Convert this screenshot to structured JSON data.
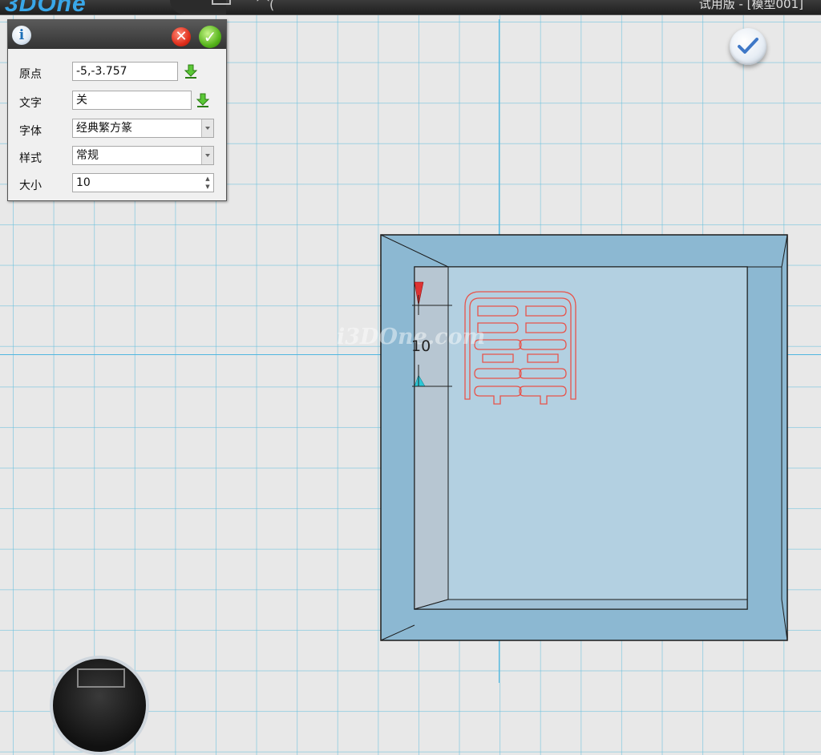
{
  "app": {
    "logo": "3DOne",
    "window_title": "试用版 - [模型001]"
  },
  "panel": {
    "rows": [
      {
        "label": "原点",
        "value": "-5,-3.757"
      },
      {
        "label": "文字",
        "value": "关"
      },
      {
        "label": "字体",
        "value": "经典繁方篆"
      },
      {
        "label": "样式",
        "value": "常规"
      },
      {
        "label": "大小",
        "value": "10"
      }
    ]
  },
  "viewport": {
    "dimension_text": "10",
    "watermark": "i3DOne.com"
  },
  "icons": {
    "info": "info-icon",
    "close": "close-icon",
    "ok": "ok-check-icon",
    "pick": "pick-point-arrow-icon",
    "confirm": "confirm-check-icon"
  },
  "colors": {
    "grid": "#64bedc",
    "axis": "#4fb6e0",
    "box_fill": "#8fb9d3",
    "text_outline": "#e8534a",
    "ok_green": "#57b51c",
    "close_red": "#e02f1c"
  }
}
